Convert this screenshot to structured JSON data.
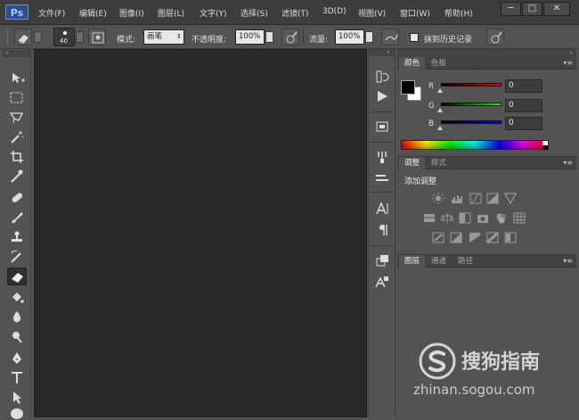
{
  "app": {
    "logo": "Ps"
  },
  "menu": [
    "文件(F)",
    "编辑(E)",
    "图像(I)",
    "图层(L)",
    "文字(Y)",
    "选择(S)",
    "滤镜(T)",
    "3D(D)",
    "视图(V)",
    "窗口(W)",
    "帮助(H)"
  ],
  "window_controls": {
    "minimize": "─",
    "restore": "□",
    "close": "✕"
  },
  "options": {
    "brush_size": "40",
    "mode_label": "模式:",
    "mode_value": "画笔",
    "opacity_label": "不透明度:",
    "opacity_value": "100%",
    "flow_label": "流量:",
    "flow_value": "100%",
    "history_label": "抹到历史记录"
  },
  "color_panel": {
    "tabs": [
      "颜色",
      "色板"
    ],
    "channels": [
      {
        "label": "R",
        "value": "0"
      },
      {
        "label": "G",
        "value": "0"
      },
      {
        "label": "B",
        "value": "0"
      }
    ],
    "foreground": "#000000",
    "background": "#ffffff"
  },
  "adjust_panel": {
    "tabs": [
      "调整",
      "样式"
    ],
    "title": "添加调整"
  },
  "layers_panel": {
    "tabs": [
      "图层",
      "通道",
      "路径"
    ]
  },
  "watermark": {
    "brand": "搜狗指南",
    "url": "zhinan.sogou.com"
  },
  "colors": {
    "accent": "#2b4f8f",
    "canvas": "#282828",
    "panel": "#535353"
  }
}
